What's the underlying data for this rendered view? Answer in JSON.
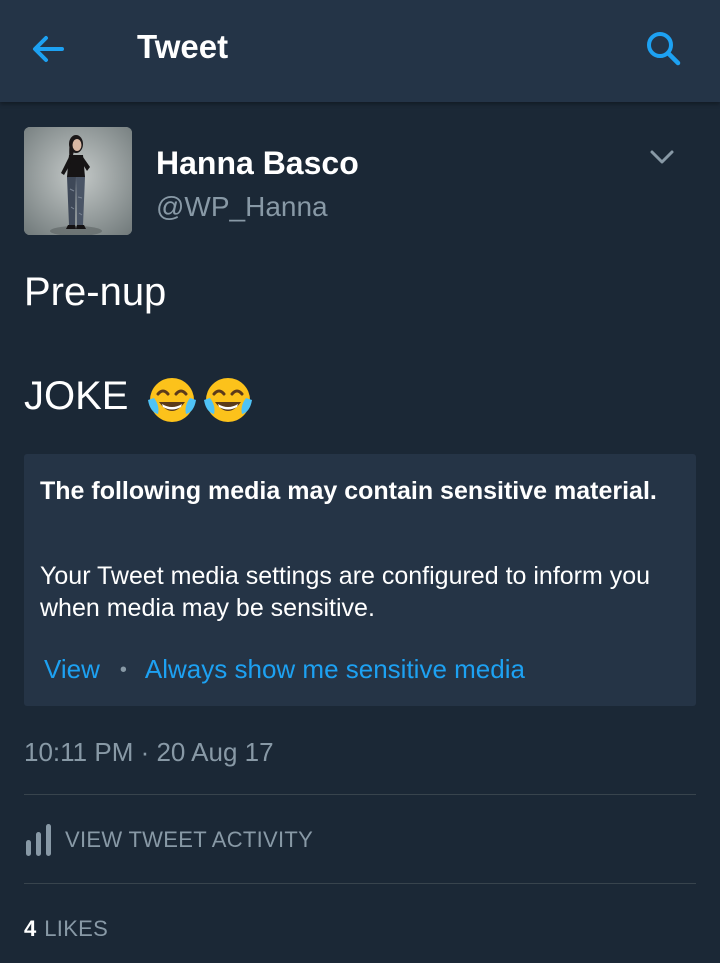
{
  "header": {
    "title": "Tweet",
    "back_icon": "arrow-left-icon",
    "search_icon": "search-icon"
  },
  "tweet": {
    "display_name": "Hanna Basco",
    "handle": "@WP_Hanna",
    "text_line1": "Pre-nup",
    "text_line2": "JOKE",
    "emojis": [
      "face-with-tears-of-joy",
      "face-with-tears-of-joy"
    ],
    "timestamp": "10:11 PM · 20 Aug 17"
  },
  "sensitive_notice": {
    "heading": "The following media may contain sensitive material.",
    "body": "Your Tweet media settings are configured to inform you when media may be sensitive.",
    "view_label": "View",
    "separator": "•",
    "always_show_label": "Always show me sensitive media"
  },
  "activity": {
    "label": "VIEW TWEET ACTIVITY"
  },
  "likes": {
    "count": "4",
    "label": "LIKES"
  },
  "colors": {
    "background": "#1b2836",
    "header": "#243447",
    "accent": "#1da1f2",
    "secondary_text": "#8899a6",
    "card": "#253446",
    "divider": "#38444d"
  }
}
